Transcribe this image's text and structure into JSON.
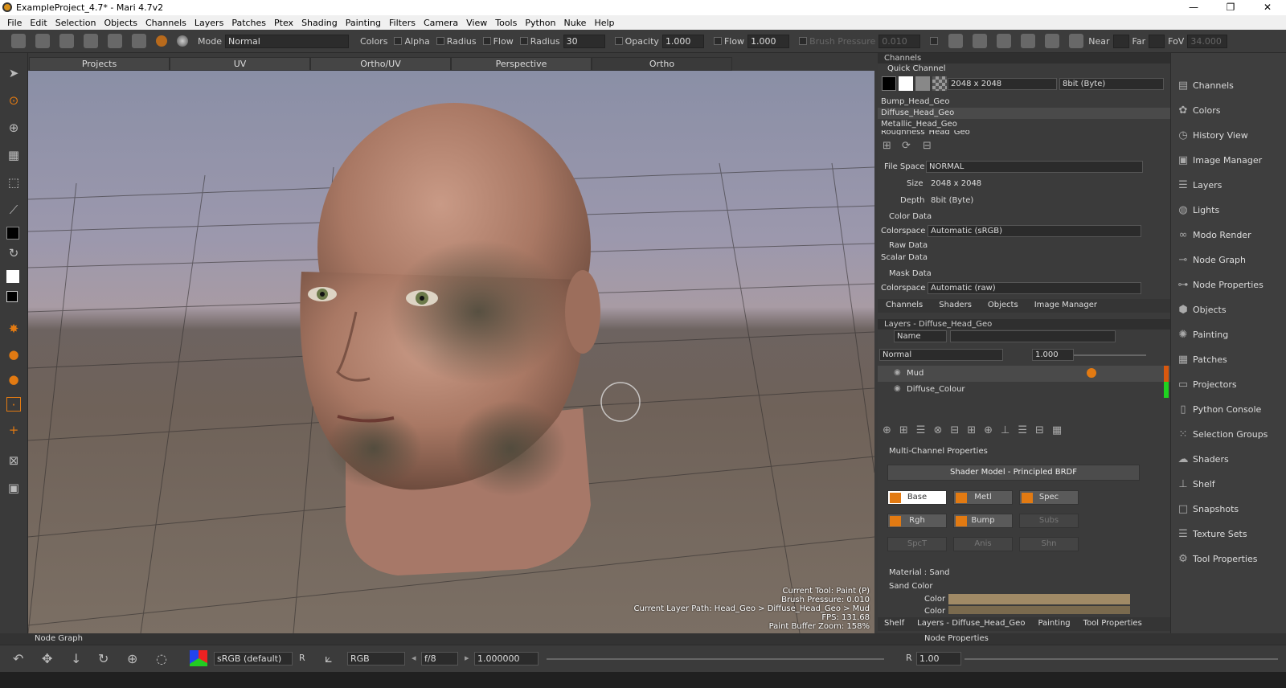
{
  "window": {
    "title": "ExampleProject_4.7* - Mari 4.7v2",
    "min": "—",
    "max": "❐",
    "close": "✕"
  },
  "menu": [
    "File",
    "Edit",
    "Selection",
    "Objects",
    "Channels",
    "Layers",
    "Patches",
    "Ptex",
    "Shading",
    "Painting",
    "Filters",
    "Camera",
    "View",
    "Tools",
    "Python",
    "Nuke",
    "Help"
  ],
  "toolbar": {
    "mode_label": "Mode",
    "mode_value": "Normal",
    "colors": "Colors",
    "alpha": "Alpha",
    "radius_label": "Radius",
    "flow_label": "Flow",
    "radius_field_label": "Radius",
    "radius_value": "30",
    "opacity_label": "Opacity",
    "opacity_value": "1.000",
    "flow2_label": "Flow",
    "flow_value": "1.000",
    "brush_pressure_label": "Brush Pressure",
    "brush_pressure_value": "0.010",
    "near": "Near",
    "far": "Far",
    "fov": "FoV",
    "fov_value": "34.000"
  },
  "view_tabs": [
    "Projects",
    "UV",
    "Ortho/UV",
    "Perspective",
    "Ortho"
  ],
  "status": {
    "line1": "Current Tool: Paint (P)",
    "line2": "Brush Pressure: 0.010",
    "line3": "Current Layer Path: Head_Geo > Diffuse_Head_Geo > Mud",
    "line4": "FPS: 131.68",
    "line5": "Paint Buffer Zoom: 158%"
  },
  "channels": {
    "header": "Channels",
    "quick": "Quick Channel",
    "size": "2048 x 2048",
    "depth": "8bit (Byte)",
    "list": [
      "Bump_Head_Geo",
      "Diffuse_Head_Geo",
      "Metallic_Head_Geo",
      "Roughness_Head_Geo"
    ],
    "file_space_label": "File Space",
    "file_space": "NORMAL",
    "size_label": "Size",
    "size_value": "2048 x 2048",
    "depth_label": "Depth",
    "depth_value": "8bit (Byte)",
    "color_data": "Color Data",
    "colorspace_label": "Colorspace",
    "colorspace": "Automatic (sRGB)",
    "raw": "Raw Data",
    "scalar": "Scalar Data",
    "mask_data": "Mask Data",
    "mask_colorspace": "Automatic (raw)"
  },
  "panel_tabs": [
    "Channels",
    "Shaders",
    "Objects",
    "Image Manager"
  ],
  "layers": {
    "header": "Layers - Diffuse_Head_Geo",
    "name_filter": "Name",
    "blend": "Normal",
    "opacity": "1.000",
    "items": [
      "Mud",
      "Diffuse_Colour"
    ]
  },
  "mcp": {
    "header": "Multi-Channel Properties",
    "shader_model": "Shader Model - Principled BRDF",
    "buttons": [
      "Base",
      "Metl",
      "Spec",
      "Rgh",
      "Bump",
      "Subs",
      "SpcT",
      "Anis",
      "Shn"
    ]
  },
  "material": {
    "header": "Material : Sand",
    "sub": "Sand Color",
    "color_label": "Color",
    "color1": "#a08a66",
    "color2": "#7a6a4e"
  },
  "bottom_tabs": [
    "Shelf",
    "Layers - Diffuse_Head_Geo",
    "Painting",
    "Tool Properties"
  ],
  "right_strip": [
    "Channels",
    "Colors",
    "History View",
    "Image Manager",
    "Layers",
    "Lights",
    "Modo Render",
    "Node Graph",
    "Node Properties",
    "Objects",
    "Painting",
    "Patches",
    "Projectors",
    "Python Console",
    "Selection Groups",
    "Shaders",
    "Shelf",
    "Snapshots",
    "Texture Sets",
    "Tool Properties"
  ],
  "bottom": {
    "node_graph": "Node Graph",
    "node_props": "Node Properties",
    "colorspace": "sRGB (default)",
    "r": "R",
    "channel": "RGB",
    "fstop": "f/8",
    "exposure": "1.000000",
    "gamma_r": "R",
    "gamma": "1.00"
  },
  "colors": {
    "accent": "#e27a12",
    "green": "#1fd21f",
    "orange_bar": "#d9580e"
  }
}
